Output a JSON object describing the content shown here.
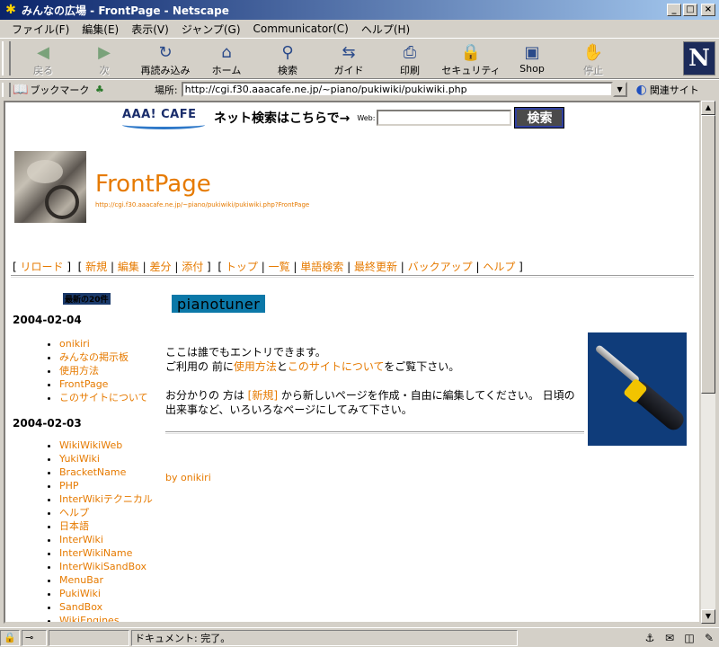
{
  "window": {
    "title": "みんなの広場 - FrontPage - Netscape"
  },
  "menu": [
    "ファイル(F)",
    "編集(E)",
    "表示(V)",
    "ジャンプ(G)",
    "Communicator(C)",
    "ヘルプ(H)"
  ],
  "toolbar": [
    {
      "label": "戻る",
      "icon": "back-arrow-icon",
      "glyph": "◀",
      "disabled": true
    },
    {
      "label": "次",
      "icon": "forward-arrow-icon",
      "glyph": "▶",
      "disabled": true
    },
    {
      "label": "再読み込み",
      "icon": "reload-icon",
      "glyph": "↻",
      "disabled": false
    },
    {
      "label": "ホーム",
      "icon": "home-icon",
      "glyph": "⌂",
      "disabled": false
    },
    {
      "label": "検索",
      "icon": "search-icon",
      "glyph": "⚲",
      "disabled": false
    },
    {
      "label": "ガイド",
      "icon": "guide-icon",
      "glyph": "⇆",
      "disabled": false
    },
    {
      "label": "印刷",
      "icon": "print-icon",
      "glyph": "⎙",
      "disabled": false
    },
    {
      "label": "セキュリティ",
      "icon": "security-lock-icon",
      "glyph": "🔒",
      "disabled": false
    },
    {
      "label": "Shop",
      "icon": "shop-icon",
      "glyph": "▣",
      "disabled": false
    },
    {
      "label": "停止",
      "icon": "stop-icon",
      "glyph": "✋",
      "disabled": true
    }
  ],
  "location": {
    "bookmark_label": "ブックマーク",
    "location_label": "場所:",
    "url": "http://cgi.f30.aaacafe.ne.jp/~piano/pukiwiki/pukiwiki.php",
    "related_label": "関連サイト"
  },
  "page": {
    "search_banner": {
      "logo_text": "AAA! CAFE",
      "caption": "ネット検索はこちらで→",
      "web_label": "Web:",
      "button": "検索"
    },
    "title": "FrontPage",
    "title_url": "http://cgi.f30.aaacafe.ne.jp/~piano/pukiwiki/pukiwiki.php?FrontPage",
    "nav_groups": [
      [
        "リロード"
      ],
      [
        "新規",
        "編集",
        "差分",
        "添付"
      ],
      [
        "トップ",
        "一覧",
        "単語検索",
        "最終更新",
        "バックアップ",
        "ヘルプ"
      ]
    ],
    "sidebar": {
      "recent_title": "最新の20件",
      "groups": [
        {
          "date": "2004-02-04",
          "items": [
            "onikiri",
            "みんなの掲示板",
            "使用方法",
            "FrontPage",
            "このサイトについて"
          ]
        },
        {
          "date": "2004-02-03",
          "items": [
            "WikiWikiWeb",
            "YukiWiki",
            "BracketName",
            "PHP",
            "InterWikiテクニカル",
            "ヘルプ",
            "日本語",
            "InterWiki",
            "InterWikiName",
            "InterWikiSandBox",
            "MenuBar",
            "PukiWiki",
            "SandBox",
            "WikiEngines"
          ]
        }
      ]
    },
    "main": {
      "heading": "pianotuner",
      "p1_line1": "ここは誰でもエントリできます。",
      "p1_pre": "ご利用の 前に",
      "p1_link1": "使用方法",
      "p1_mid": "と",
      "p1_link2": "このサイトについて",
      "p1_post": "をご覧下さい。",
      "p2_pre": "お分かりの 方は ",
      "p2_link": "[新規]",
      "p2_post": " から新しいページを作成・自由に編集してください。 日頃の出来事など、いろいろなページにしてみて下さい。",
      "byline_pre": "by ",
      "byline_link": "onikiri"
    }
  },
  "status": {
    "text": "ドキュメント: 完了。"
  }
}
